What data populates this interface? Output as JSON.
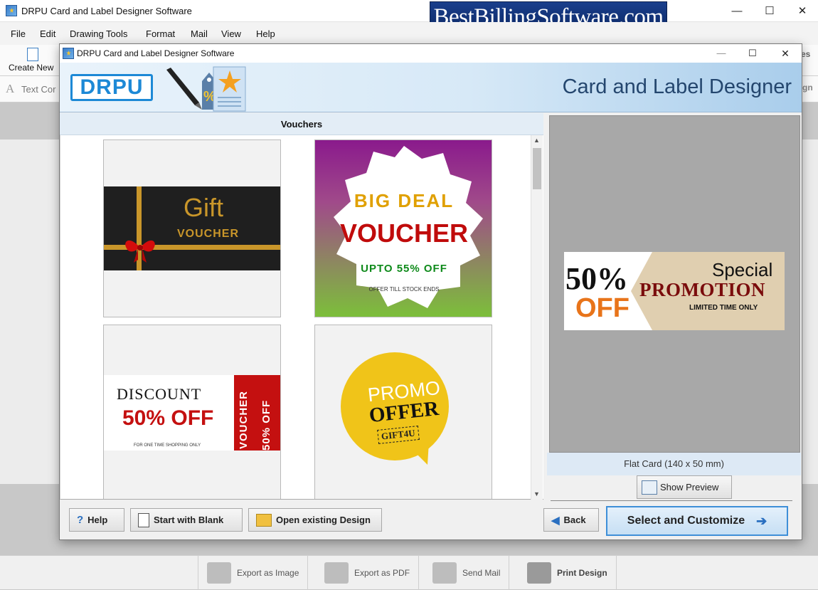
{
  "main_window": {
    "title": "DRPU Card and Label Designer Software",
    "minimize": "—",
    "maximize": "☐",
    "close": "✕"
  },
  "banner": {
    "text": "BestBillingSoftware.com"
  },
  "menu": [
    "File",
    "Edit",
    "Drawing Tools",
    "Format",
    "Mail",
    "View",
    "Help"
  ],
  "toolbar": {
    "create_new": "Create New",
    "text_partial": "Text Cor",
    "right_partial_1": "es",
    "right_partial_2": "gn"
  },
  "dialog": {
    "title": "DRPU Card and Label Designer Software",
    "logo_text": "DRPU",
    "header_title": "Card and Label Designer",
    "section_title": "Vouchers",
    "tiles": [
      {
        "line1": "Gift",
        "line2": "VOUCHER"
      },
      {
        "line1": "BIG DEAL",
        "line2": "VOUCHER",
        "line3": "UPTO 55% OFF",
        "line4": "OFFER TILL STOCK ENDS"
      },
      {
        "line1": "DISCOUNT",
        "line2": "50% OFF",
        "line3": "FOR ONE TIME SHOPPING ONLY",
        "side1": "VOUCHER",
        "side2": "50% OFF"
      },
      {
        "line1": "PROMO",
        "line2": "OFFER",
        "line3": "GIFT4U"
      }
    ],
    "preview": {
      "big1": "50%",
      "big2": "OFF",
      "special": "Special",
      "promo": "PROMOTION",
      "limited": "LIMITED TIME ONLY"
    },
    "card_size": "Flat Card (140 x 50 mm)",
    "show_preview": "Show Preview",
    "buttons": {
      "help": "Help",
      "start_blank": "Start with Blank",
      "open_existing": "Open existing Design",
      "back": "Back",
      "select": "Select and Customize"
    }
  },
  "bottom_bar": [
    "Export as Image",
    "Export as PDF",
    "Send Mail",
    "Print Design"
  ],
  "colors": {
    "accent": "#3e8fd8",
    "brand": "#1d89d6",
    "gold": "#c9962a",
    "promo_red": "#7a0c0c"
  }
}
